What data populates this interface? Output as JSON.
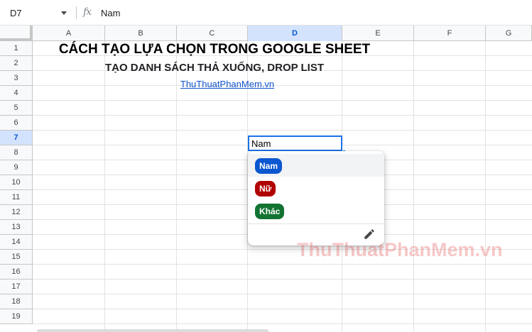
{
  "formula_bar": {
    "name_box": "D7",
    "fx_label": "fx",
    "formula_value": "Nam"
  },
  "columns": [
    {
      "label": "A",
      "selected": false
    },
    {
      "label": "B",
      "selected": false
    },
    {
      "label": "C",
      "selected": false
    },
    {
      "label": "D",
      "selected": true
    },
    {
      "label": "E",
      "selected": false
    },
    {
      "label": "F",
      "selected": false
    },
    {
      "label": "G",
      "selected": false
    }
  ],
  "rows": [
    "1",
    "2",
    "3",
    "4",
    "5",
    "6",
    "7",
    "8",
    "9",
    "10",
    "11",
    "12",
    "13",
    "14",
    "15",
    "16",
    "17",
    "18",
    "19"
  ],
  "selected_row": "7",
  "cells": {
    "title": "CÁCH TẠO LỰA CHỌN TRONG GOOGLE SHEET",
    "subtitle": "TẠO DANH SÁCH THẢ XUỐNG, DROP LIST",
    "link": "ThuThuatPhanMem.vn",
    "active_value": "Nam"
  },
  "dropdown": {
    "options": [
      {
        "label": "Nam",
        "color": "#0b57d0"
      },
      {
        "label": "Nữ",
        "color": "#b10202"
      },
      {
        "label": "Khác",
        "color": "#137333"
      }
    ],
    "edit_icon": "pencil-icon"
  },
  "watermark": "ThuThuatPhanMem.vn",
  "colors": {
    "accent": "#1a73e8",
    "header_selected": "#d3e3fd",
    "link": "#1155cc"
  }
}
